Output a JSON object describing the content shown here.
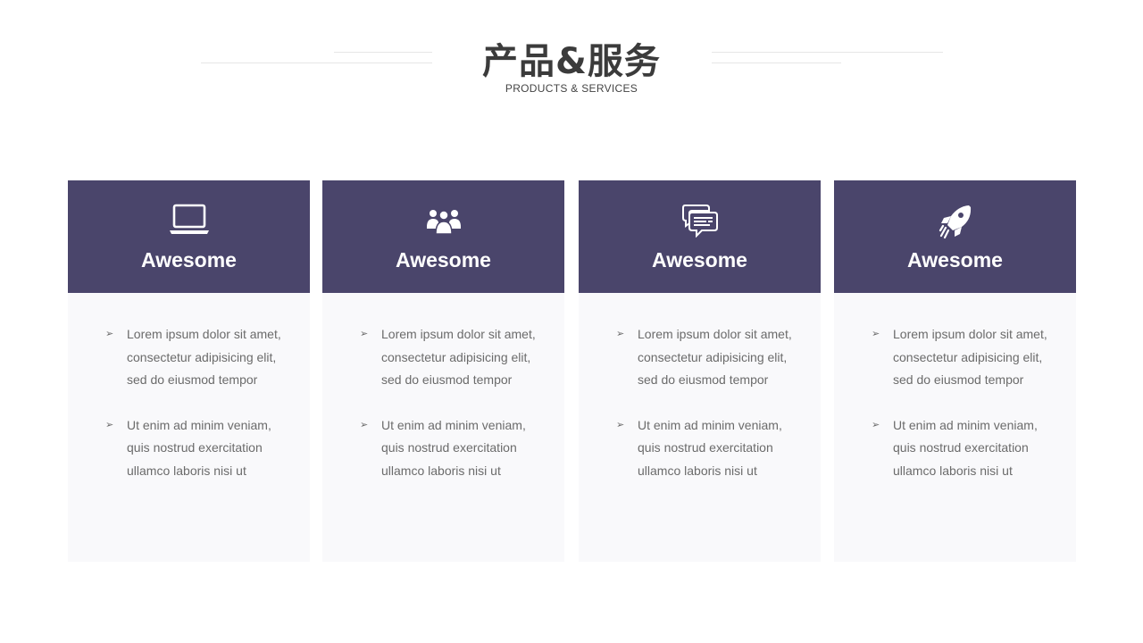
{
  "header": {
    "title": "产品&服务",
    "subtitle": "PRODUCTS & SERVICES"
  },
  "theme": {
    "card_header_color": "#4a456b",
    "card_body_color": "#f9f9fb",
    "text_color": "#6b6b6b"
  },
  "cards": [
    {
      "icon": "laptop-icon",
      "title": "Awesome",
      "bullets": [
        "Lorem ipsum dolor sit amet, consectetur adipisicing elit, sed do eiusmod tempor",
        "Ut enim ad minim veniam, quis nostrud exercitation ullamco laboris nisi ut"
      ]
    },
    {
      "icon": "team-icon",
      "title": "Awesome",
      "bullets": [
        "Lorem ipsum dolor sit amet, consectetur adipisicing elit, sed do eiusmod tempor",
        "Ut enim ad minim veniam, quis nostrud exercitation ullamco laboris nisi ut"
      ]
    },
    {
      "icon": "chat-icon",
      "title": "Awesome",
      "bullets": [
        "Lorem ipsum dolor sit amet, consectetur adipisicing elit, sed do eiusmod tempor",
        "Ut enim ad minim veniam, quis nostrud exercitation ullamco laboris nisi ut"
      ]
    },
    {
      "icon": "rocket-icon",
      "title": "Awesome",
      "bullets": [
        "Lorem ipsum dolor sit amet, consectetur adipisicing elit, sed do eiusmod tempor",
        "Ut enim ad minim veniam, quis nostrud exercitation ullamco laboris nisi ut"
      ]
    }
  ]
}
